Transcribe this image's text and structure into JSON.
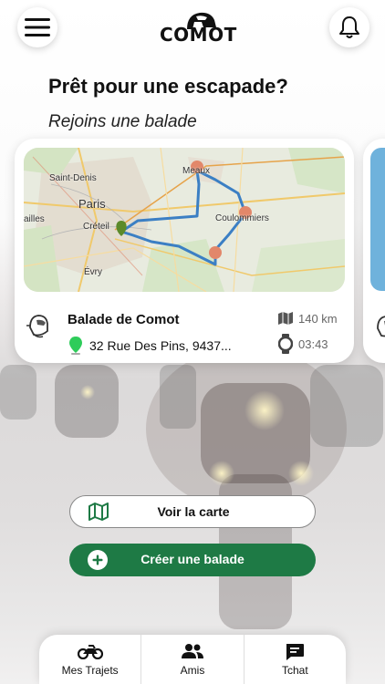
{
  "header": {
    "logo_text": "COMOT"
  },
  "main": {
    "headline": "Prêt pour une escapade?",
    "subheadline": "Rejoins une balade"
  },
  "ride_card": {
    "title": "Balade de Comot",
    "address": "32 Rue Des Pins, 9437...",
    "distance": "140 km",
    "duration": "03:43",
    "map_labels": {
      "saint_denis": "Saint-Denis",
      "paris": "Paris",
      "creteil": "Créteil",
      "evry": "Évry",
      "meaux": "Meaux",
      "coulommiers": "Coulommiers",
      "sailles": "ailles"
    }
  },
  "actions": {
    "view_map_label": "Voir la carte",
    "create_ride_label": "Créer une balade"
  },
  "tabbar": {
    "tabs": [
      {
        "label": "Mes Trajets",
        "icon": "motorcycle-icon"
      },
      {
        "label": "Amis",
        "icon": "friends-icon"
      },
      {
        "label": "Tchat",
        "icon": "chat-icon"
      }
    ]
  },
  "colors": {
    "accent_green": "#1e7a45",
    "route_blue": "#3b7fc4",
    "marker_orange": "#e2876a",
    "start_marker_green": "#5c8a2a"
  }
}
